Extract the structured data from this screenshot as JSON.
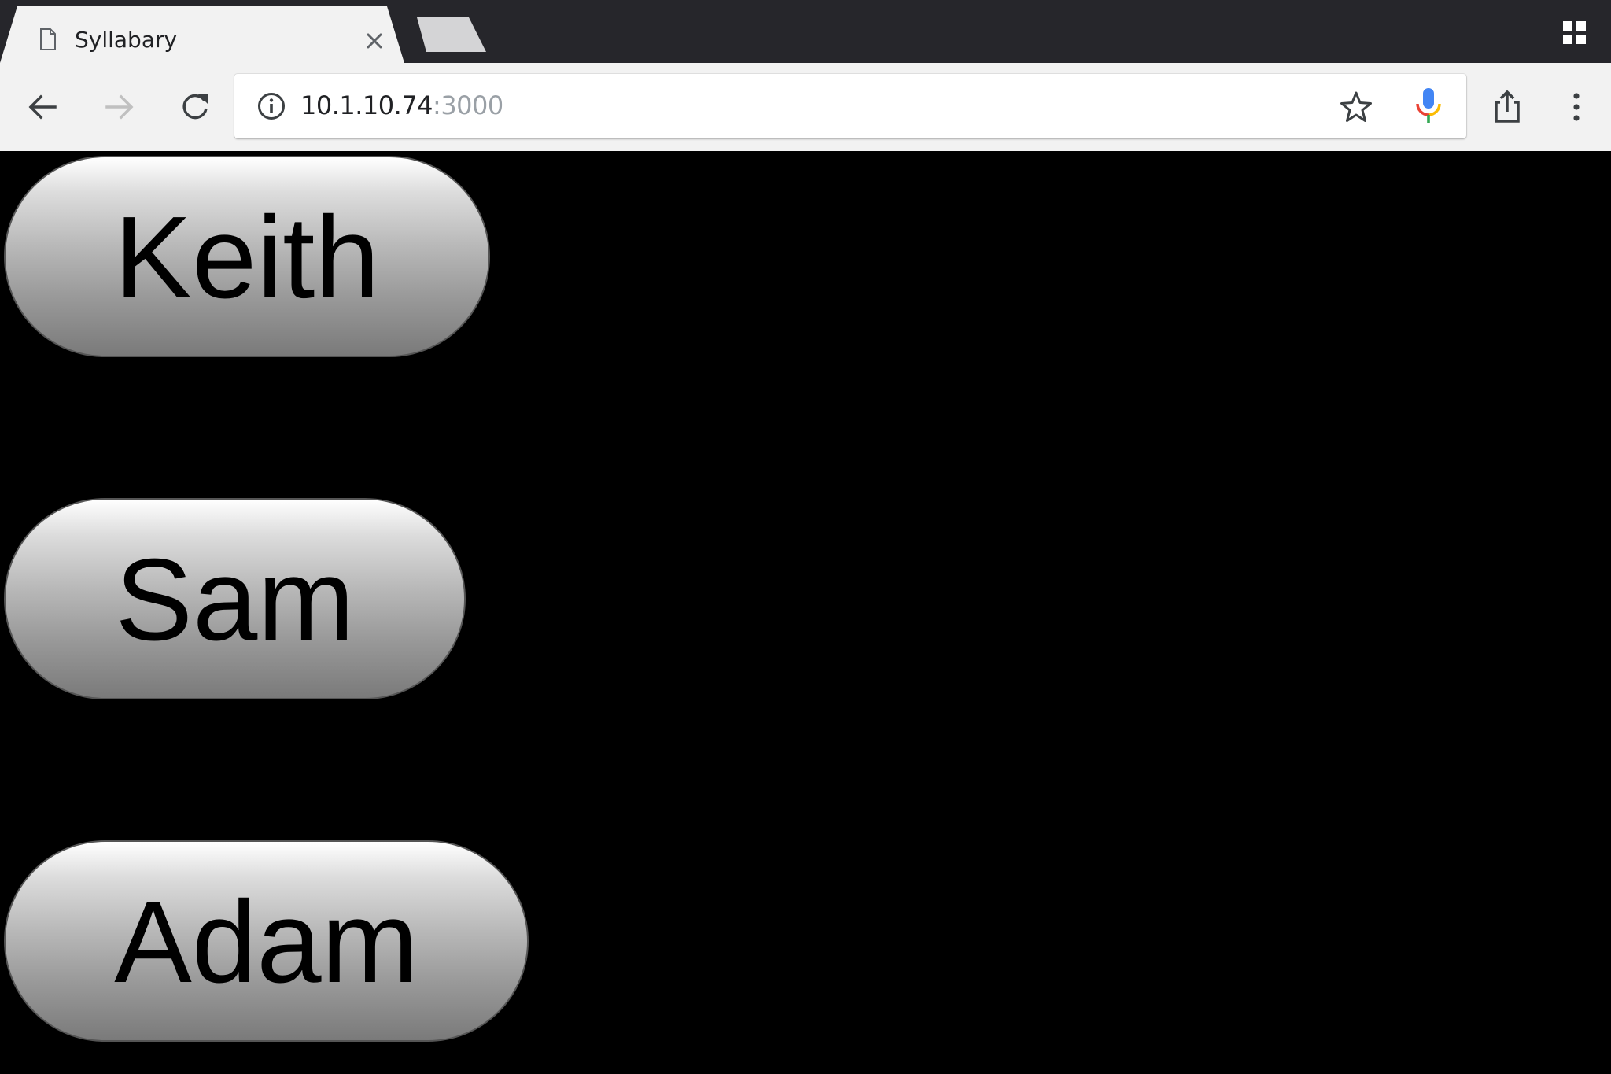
{
  "browser": {
    "tab": {
      "title": "Syllabary",
      "icon": "document-icon",
      "close_icon": "close-icon"
    },
    "new_tab_icon": "new-tab-icon",
    "tab_switcher_icon": "tab-switcher-icon",
    "toolbar": {
      "back_icon": "back-arrow-icon",
      "forward_icon": "forward-arrow-icon",
      "reload_icon": "reload-icon",
      "share_icon": "share-icon",
      "menu_icon": "more-vert-icon"
    },
    "omnibox": {
      "info_icon": "info-icon",
      "url_host": "10.1.10.74",
      "url_port": ":3000",
      "bookmark_icon": "star-icon",
      "voice_icon": "mic-icon"
    },
    "colors": {
      "tabstrip": "#26262b",
      "toolbar": "#f2f2f2",
      "page_background": "#000000"
    }
  },
  "page": {
    "buttons": [
      {
        "label": "Keith"
      },
      {
        "label": "Sam"
      },
      {
        "label": "Adam"
      }
    ]
  }
}
